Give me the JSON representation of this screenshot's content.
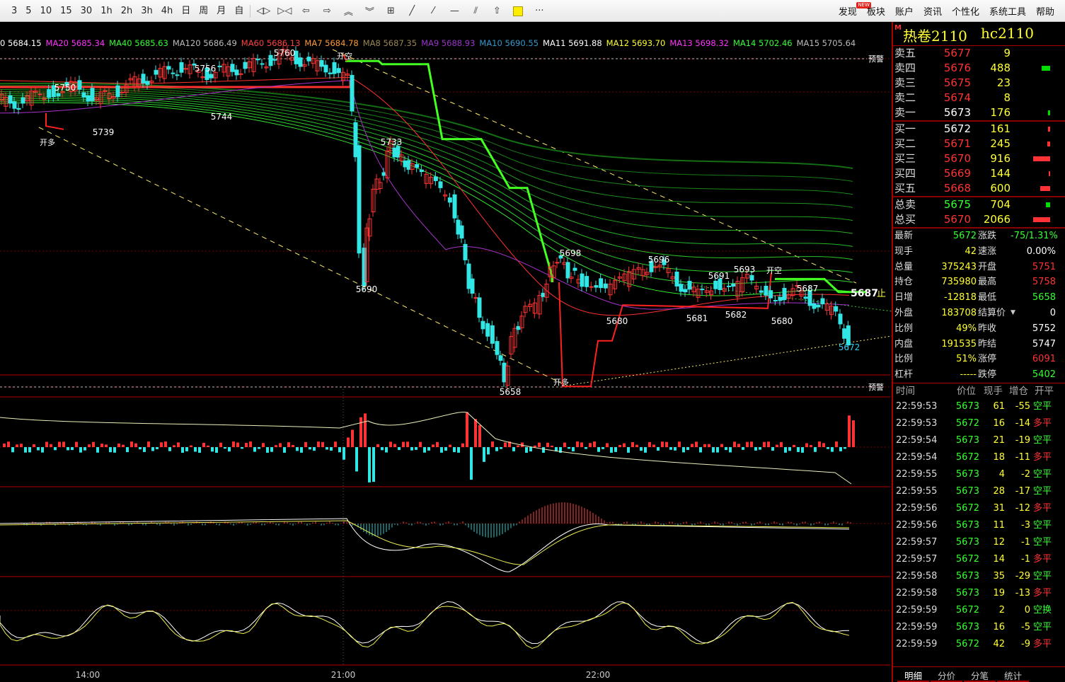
{
  "toolbar": {
    "periods": [
      "3",
      "5",
      "10",
      "15",
      "30",
      "1h",
      "2h",
      "3h",
      "4h",
      "日",
      "周",
      "月",
      "自"
    ],
    "menu": [
      "发现",
      "板块",
      "账户",
      "资讯",
      "个性化",
      "系统工具",
      "帮助"
    ],
    "new_badge": "NEW",
    "icons": [
      "zoom-in-out-icon",
      "zoom-fit-icon",
      "arrow-left-icon",
      "arrow-right-icon",
      "arrow-up-double-icon",
      "arrow-down-double-icon",
      "layout-grid-icon",
      "draw-line-icon",
      "draw-ray-icon",
      "horizontal-line-icon",
      "parallel-line-icon",
      "arrow-up-icon",
      "color-picker-icon",
      "more-icon"
    ]
  },
  "ma_legend": [
    {
      "text": "0 5684.15",
      "color": "#ffffff"
    },
    {
      "text": "MA20 5685.34",
      "color": "#ff33ff"
    },
    {
      "text": "MA40 5685.63",
      "color": "#33ff33"
    },
    {
      "text": "MA120 5686.49",
      "color": "#bbbbbb"
    },
    {
      "text": "MA60 5686.13",
      "color": "#ff4040"
    },
    {
      "text": "MA7 5684.78",
      "color": "#ff9933"
    },
    {
      "text": "MA8 5687.35",
      "color": "#998855"
    },
    {
      "text": "MA9 5688.93",
      "color": "#9933cc"
    },
    {
      "text": "MA10 5690.55",
      "color": "#3399cc"
    },
    {
      "text": "MA11 5691.88",
      "color": "#ffffff"
    },
    {
      "text": "MA12 5693.70",
      "color": "#ffff33"
    },
    {
      "text": "MA13 5698.32",
      "color": "#ff33ff"
    },
    {
      "text": "MA14 5702.46",
      "color": "#33ff33"
    },
    {
      "text": "MA15 5705.64",
      "color": "#bbbbbb"
    }
  ],
  "chart": {
    "labels": {
      "warn_top": "预警",
      "warn_bottom": "预警",
      "open_short": "开空",
      "open_long": "开多",
      "stop_price": "5687",
      "stop_tag": "止",
      "last_price_tag": "5672",
      "pivots": [
        "5760",
        "5756",
        "5750",
        "5744",
        "5739",
        "5733",
        "5690",
        "5698",
        "5696",
        "5691",
        "5693",
        "5687",
        "5680",
        "5681",
        "5682",
        "5680",
        "5658"
      ]
    },
    "time_axis": [
      "14:00",
      "21:00",
      "22:00"
    ]
  },
  "chart_data": {
    "type": "candlestick",
    "title": "",
    "price_range": [
      5655,
      5765
    ],
    "pivot_highs": [
      5750,
      5756,
      5760,
      5733,
      5698,
      5696,
      5691,
      5693,
      5687
    ],
    "pivot_lows": [
      5739,
      5744,
      5690,
      5658,
      5680,
      5681,
      5682,
      5680
    ],
    "last_price": 5672,
    "stop_line": 5687,
    "x_ticks": [
      "14:00",
      "21:00",
      "22:00"
    ]
  },
  "panel": {
    "marker": "M",
    "name": "热卷2110",
    "code": "hc2110",
    "asks": [
      {
        "label": "卖五",
        "price": "5677",
        "vol": "9",
        "bar": 0
      },
      {
        "label": "卖四",
        "price": "5676",
        "vol": "488",
        "bar": 12
      },
      {
        "label": "卖三",
        "price": "5675",
        "vol": "23",
        "bar": 0
      },
      {
        "label": "卖二",
        "price": "5674",
        "vol": "8",
        "bar": 0
      },
      {
        "label": "卖一",
        "price": "5673",
        "vol": "176",
        "bar": 3
      }
    ],
    "bids": [
      {
        "label": "买一",
        "price": "5672",
        "vol": "161",
        "bar": 3
      },
      {
        "label": "买二",
        "price": "5671",
        "vol": "245",
        "bar": 4
      },
      {
        "label": "买三",
        "price": "5670",
        "vol": "916",
        "bar": 24
      },
      {
        "label": "买四",
        "price": "5669",
        "vol": "144",
        "bar": 2
      },
      {
        "label": "买五",
        "price": "5668",
        "vol": "600",
        "bar": 14
      }
    ],
    "totals": [
      {
        "label": "总卖",
        "price": "5675",
        "vol": "704",
        "bar": 6,
        "color": "#33ff33",
        "bar_color": "#00dd00"
      },
      {
        "label": "总买",
        "price": "5670",
        "vol": "2066",
        "bar": 24,
        "color": "#ff3333",
        "bar_color": "#ff3333"
      }
    ],
    "quotes": [
      {
        "l1": "最新",
        "v1": "5672",
        "c1": "#33ff33",
        "l2": "涨跌",
        "v2": "-75/1.31%",
        "c2": "#33ff33"
      },
      {
        "l1": "现手",
        "v1": "42",
        "c1": "#ffff33",
        "l2": "速涨",
        "v2": "0.00%",
        "c2": "#ffffff"
      },
      {
        "l1": "总量",
        "v1": "375243",
        "c1": "#ffff33",
        "l2": "开盘",
        "v2": "5751",
        "c2": "#ff3333"
      },
      {
        "l1": "持仓",
        "v1": "735980",
        "c1": "#ffff33",
        "l2": "最高",
        "v2": "5758",
        "c2": "#ff3333"
      },
      {
        "l1": "日增",
        "v1": "-12818",
        "c1": "#ffff33",
        "l2": "最低",
        "v2": "5658",
        "c2": "#33ff33"
      },
      {
        "l1": "外盘",
        "v1": "183708",
        "c1": "#ffff33",
        "l2": "结算价",
        "v2": "0",
        "c2": "#ffffff"
      },
      {
        "l1": "比例",
        "v1": "49%",
        "c1": "#ffff33",
        "l2": "昨收",
        "v2": "5752",
        "c2": "#ffffff"
      },
      {
        "l1": "内盘",
        "v1": "191535",
        "c1": "#ffff33",
        "l2": "昨结",
        "v2": "5747",
        "c2": "#ffffff"
      },
      {
        "l1": "比例",
        "v1": "51%",
        "c1": "#ffff33",
        "l2": "涨停",
        "v2": "6091",
        "c2": "#ff3333"
      },
      {
        "l1": "杠杆",
        "v1": "-----",
        "c1": "#ffff33",
        "l2": "跌停",
        "v2": "5402",
        "c2": "#33ff33"
      }
    ],
    "trades_header": [
      "时间",
      "价位",
      "现手",
      "增仓",
      "开平"
    ],
    "trades": [
      {
        "time": "22:59:53",
        "price": "5673",
        "qty": "61",
        "oi": "-55",
        "type": "空平",
        "pc": "#33ff33",
        "tc": "#33ff33"
      },
      {
        "time": "22:59:53",
        "price": "5672",
        "qty": "16",
        "oi": "-14",
        "type": "多平",
        "pc": "#33ff33",
        "tc": "#ff3333"
      },
      {
        "time": "22:59:54",
        "price": "5673",
        "qty": "21",
        "oi": "-19",
        "type": "空平",
        "pc": "#33ff33",
        "tc": "#33ff33"
      },
      {
        "time": "22:59:54",
        "price": "5672",
        "qty": "18",
        "oi": "-11",
        "type": "多平",
        "pc": "#33ff33",
        "tc": "#ff3333"
      },
      {
        "time": "22:59:55",
        "price": "5673",
        "qty": "4",
        "oi": "-2",
        "type": "空平",
        "pc": "#33ff33",
        "tc": "#33ff33"
      },
      {
        "time": "22:59:55",
        "price": "5673",
        "qty": "28",
        "oi": "-17",
        "type": "空平",
        "pc": "#33ff33",
        "tc": "#33ff33"
      },
      {
        "time": "22:59:56",
        "price": "5672",
        "qty": "31",
        "oi": "-12",
        "type": "多平",
        "pc": "#33ff33",
        "tc": "#ff3333"
      },
      {
        "time": "22:59:56",
        "price": "5673",
        "qty": "11",
        "oi": "-3",
        "type": "空平",
        "pc": "#33ff33",
        "tc": "#33ff33"
      },
      {
        "time": "22:59:57",
        "price": "5673",
        "qty": "12",
        "oi": "-1",
        "type": "空平",
        "pc": "#33ff33",
        "tc": "#33ff33"
      },
      {
        "time": "22:59:57",
        "price": "5672",
        "qty": "14",
        "oi": "-1",
        "type": "多平",
        "pc": "#33ff33",
        "tc": "#ff3333"
      },
      {
        "time": "22:59:58",
        "price": "5673",
        "qty": "35",
        "oi": "-29",
        "type": "空平",
        "pc": "#33ff33",
        "tc": "#33ff33"
      },
      {
        "time": "22:59:58",
        "price": "5673",
        "qty": "19",
        "oi": "-13",
        "type": "多平",
        "pc": "#33ff33",
        "tc": "#ff3333"
      },
      {
        "time": "22:59:59",
        "price": "5672",
        "qty": "2",
        "oi": "0",
        "type": "空换",
        "pc": "#33ff33",
        "tc": "#33ff33"
      },
      {
        "time": "22:59:59",
        "price": "5673",
        "qty": "16",
        "oi": "-5",
        "type": "空平",
        "pc": "#33ff33",
        "tc": "#33ff33"
      },
      {
        "time": "22:59:59",
        "price": "5672",
        "qty": "42",
        "oi": "-9",
        "type": "多平",
        "pc": "#33ff33",
        "tc": "#ff3333"
      }
    ],
    "tabs": [
      "明细",
      "分价",
      "分笔",
      "统计"
    ]
  }
}
